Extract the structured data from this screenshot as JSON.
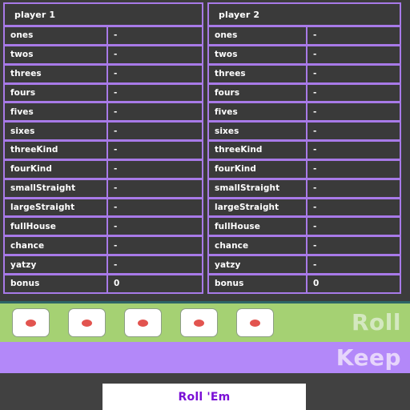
{
  "theme": {
    "page_background": "#3c3c3c",
    "cell_background": "#3a3a3a",
    "cell_border": "#a87ae8",
    "text": "#ffffff",
    "roll_band": "#a5d173",
    "roll_band_text": "#d4e8c0",
    "keep_band": "#b388f9",
    "keep_band_text": "#e6d5fb",
    "die_face": "#ffffff",
    "die_pip": "#e2544f",
    "button_text": "#7a0fd6",
    "separator": "#2e6566"
  },
  "scoreboard": {
    "players": [
      {
        "header": "player 1",
        "rows": [
          {
            "label": "ones",
            "value": "-"
          },
          {
            "label": "twos",
            "value": "-"
          },
          {
            "label": "threes",
            "value": "-"
          },
          {
            "label": "fours",
            "value": "-"
          },
          {
            "label": "fives",
            "value": "-"
          },
          {
            "label": "sixes",
            "value": "-"
          },
          {
            "label": "threeKind",
            "value": "-"
          },
          {
            "label": "fourKind",
            "value": "-"
          },
          {
            "label": "smallStraight",
            "value": "-"
          },
          {
            "label": "largeStraight",
            "value": "-"
          },
          {
            "label": "fullHouse",
            "value": "-"
          },
          {
            "label": "chance",
            "value": "-"
          },
          {
            "label": "yatzy",
            "value": "-"
          },
          {
            "label": "bonus",
            "value": "0"
          }
        ]
      },
      {
        "header": "player 2",
        "rows": [
          {
            "label": "ones",
            "value": "-"
          },
          {
            "label": "twos",
            "value": "-"
          },
          {
            "label": "threes",
            "value": "-"
          },
          {
            "label": "fours",
            "value": "-"
          },
          {
            "label": "fives",
            "value": "-"
          },
          {
            "label": "sixes",
            "value": "-"
          },
          {
            "label": "threeKind",
            "value": "-"
          },
          {
            "label": "fourKind",
            "value": "-"
          },
          {
            "label": "smallStraight",
            "value": "-"
          },
          {
            "label": "largeStraight",
            "value": "-"
          },
          {
            "label": "fullHouse",
            "value": "-"
          },
          {
            "label": "chance",
            "value": "-"
          },
          {
            "label": "yatzy",
            "value": "-"
          },
          {
            "label": "bonus",
            "value": "0"
          }
        ]
      }
    ]
  },
  "roll_area": {
    "label": "Roll",
    "dice": [
      {
        "name": "die-1",
        "pips": 1
      },
      {
        "name": "die-2",
        "pips": 1
      },
      {
        "name": "die-3",
        "pips": 1
      },
      {
        "name": "die-4",
        "pips": 1
      },
      {
        "name": "die-5",
        "pips": 1
      }
    ]
  },
  "keep_area": {
    "label": "Keep",
    "dice": []
  },
  "actions": {
    "roll_em_label": "Roll 'Em"
  }
}
